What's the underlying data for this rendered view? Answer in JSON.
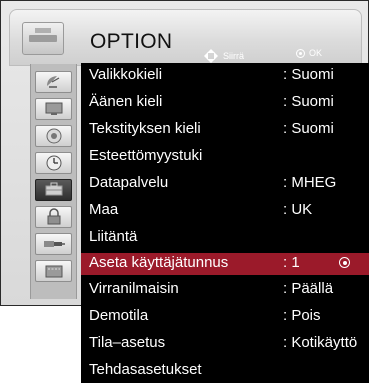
{
  "menu": {
    "title": "OPTION",
    "hints": {
      "move": "Siirrä",
      "ok": "OK"
    },
    "rows": [
      {
        "label": "Valikkokieli",
        "value": ": Suomi"
      },
      {
        "label": "Äänen kieli",
        "value": ": Suomi"
      },
      {
        "label": "Tekstityksen kieli",
        "value": ": Suomi"
      },
      {
        "label": "Esteettömyystuki",
        "value": ""
      },
      {
        "label": "Datapalvelu",
        "value": ": MHEG"
      },
      {
        "label": "Maa",
        "value": ": UK"
      },
      {
        "label": "Liitäntä",
        "value": ""
      },
      {
        "label": "Aseta käyttäjätunnus",
        "value": ": 1"
      },
      {
        "label": "Virranilmaisin",
        "value": ": Päällä"
      },
      {
        "label": "Demotila",
        "value": ": Pois"
      },
      {
        "label": "Tila–asetus",
        "value": ": Kotikäyttö"
      },
      {
        "label": "Tehdasasetukset",
        "value": ""
      }
    ],
    "selected_index": 7
  },
  "sidebar": {
    "icons": [
      "satellite-dish-icon",
      "monitor-icon",
      "speaker-icon",
      "clock-icon",
      "lock-icon-briefcase",
      "padlock-icon",
      "input-plug-icon",
      "media-icon"
    ],
    "active_index": 4
  },
  "colors": {
    "selected_row": "#9b1a2a",
    "menu_bg": "#000000"
  }
}
